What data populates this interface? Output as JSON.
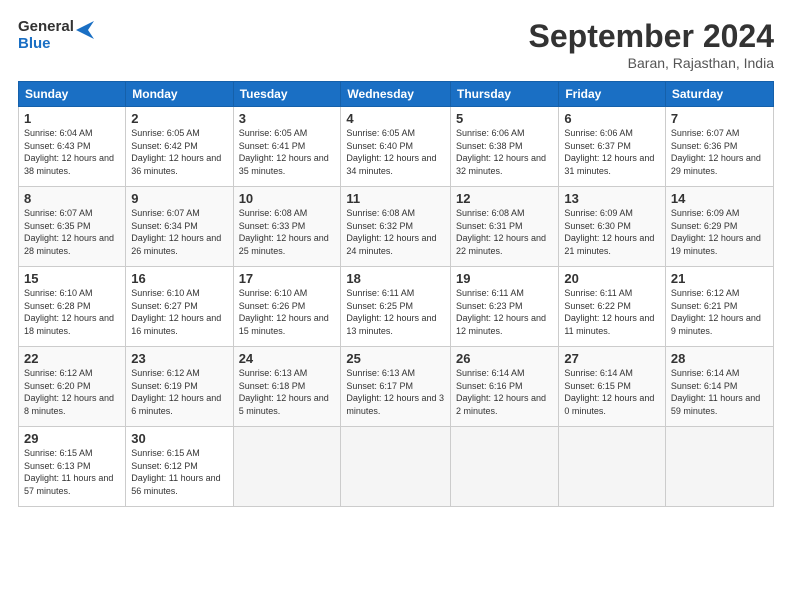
{
  "header": {
    "logo_line1": "General",
    "logo_line2": "Blue",
    "month": "September 2024",
    "location": "Baran, Rajasthan, India"
  },
  "weekdays": [
    "Sunday",
    "Monday",
    "Tuesday",
    "Wednesday",
    "Thursday",
    "Friday",
    "Saturday"
  ],
  "weeks": [
    [
      {
        "day": "1",
        "sunrise": "6:04 AM",
        "sunset": "6:43 PM",
        "daylight": "12 hours and 38 minutes."
      },
      {
        "day": "2",
        "sunrise": "6:05 AM",
        "sunset": "6:42 PM",
        "daylight": "12 hours and 36 minutes."
      },
      {
        "day": "3",
        "sunrise": "6:05 AM",
        "sunset": "6:41 PM",
        "daylight": "12 hours and 35 minutes."
      },
      {
        "day": "4",
        "sunrise": "6:05 AM",
        "sunset": "6:40 PM",
        "daylight": "12 hours and 34 minutes."
      },
      {
        "day": "5",
        "sunrise": "6:06 AM",
        "sunset": "6:38 PM",
        "daylight": "12 hours and 32 minutes."
      },
      {
        "day": "6",
        "sunrise": "6:06 AM",
        "sunset": "6:37 PM",
        "daylight": "12 hours and 31 minutes."
      },
      {
        "day": "7",
        "sunrise": "6:07 AM",
        "sunset": "6:36 PM",
        "daylight": "12 hours and 29 minutes."
      }
    ],
    [
      {
        "day": "8",
        "sunrise": "6:07 AM",
        "sunset": "6:35 PM",
        "daylight": "12 hours and 28 minutes."
      },
      {
        "day": "9",
        "sunrise": "6:07 AM",
        "sunset": "6:34 PM",
        "daylight": "12 hours and 26 minutes."
      },
      {
        "day": "10",
        "sunrise": "6:08 AM",
        "sunset": "6:33 PM",
        "daylight": "12 hours and 25 minutes."
      },
      {
        "day": "11",
        "sunrise": "6:08 AM",
        "sunset": "6:32 PM",
        "daylight": "12 hours and 24 minutes."
      },
      {
        "day": "12",
        "sunrise": "6:08 AM",
        "sunset": "6:31 PM",
        "daylight": "12 hours and 22 minutes."
      },
      {
        "day": "13",
        "sunrise": "6:09 AM",
        "sunset": "6:30 PM",
        "daylight": "12 hours and 21 minutes."
      },
      {
        "day": "14",
        "sunrise": "6:09 AM",
        "sunset": "6:29 PM",
        "daylight": "12 hours and 19 minutes."
      }
    ],
    [
      {
        "day": "15",
        "sunrise": "6:10 AM",
        "sunset": "6:28 PM",
        "daylight": "12 hours and 18 minutes."
      },
      {
        "day": "16",
        "sunrise": "6:10 AM",
        "sunset": "6:27 PM",
        "daylight": "12 hours and 16 minutes."
      },
      {
        "day": "17",
        "sunrise": "6:10 AM",
        "sunset": "6:26 PM",
        "daylight": "12 hours and 15 minutes."
      },
      {
        "day": "18",
        "sunrise": "6:11 AM",
        "sunset": "6:25 PM",
        "daylight": "12 hours and 13 minutes."
      },
      {
        "day": "19",
        "sunrise": "6:11 AM",
        "sunset": "6:23 PM",
        "daylight": "12 hours and 12 minutes."
      },
      {
        "day": "20",
        "sunrise": "6:11 AM",
        "sunset": "6:22 PM",
        "daylight": "12 hours and 11 minutes."
      },
      {
        "day": "21",
        "sunrise": "6:12 AM",
        "sunset": "6:21 PM",
        "daylight": "12 hours and 9 minutes."
      }
    ],
    [
      {
        "day": "22",
        "sunrise": "6:12 AM",
        "sunset": "6:20 PM",
        "daylight": "12 hours and 8 minutes."
      },
      {
        "day": "23",
        "sunrise": "6:12 AM",
        "sunset": "6:19 PM",
        "daylight": "12 hours and 6 minutes."
      },
      {
        "day": "24",
        "sunrise": "6:13 AM",
        "sunset": "6:18 PM",
        "daylight": "12 hours and 5 minutes."
      },
      {
        "day": "25",
        "sunrise": "6:13 AM",
        "sunset": "6:17 PM",
        "daylight": "12 hours and 3 minutes."
      },
      {
        "day": "26",
        "sunrise": "6:14 AM",
        "sunset": "6:16 PM",
        "daylight": "12 hours and 2 minutes."
      },
      {
        "day": "27",
        "sunrise": "6:14 AM",
        "sunset": "6:15 PM",
        "daylight": "12 hours and 0 minutes."
      },
      {
        "day": "28",
        "sunrise": "6:14 AM",
        "sunset": "6:14 PM",
        "daylight": "11 hours and 59 minutes."
      }
    ],
    [
      {
        "day": "29",
        "sunrise": "6:15 AM",
        "sunset": "6:13 PM",
        "daylight": "11 hours and 57 minutes."
      },
      {
        "day": "30",
        "sunrise": "6:15 AM",
        "sunset": "6:12 PM",
        "daylight": "11 hours and 56 minutes."
      },
      null,
      null,
      null,
      null,
      null
    ]
  ]
}
